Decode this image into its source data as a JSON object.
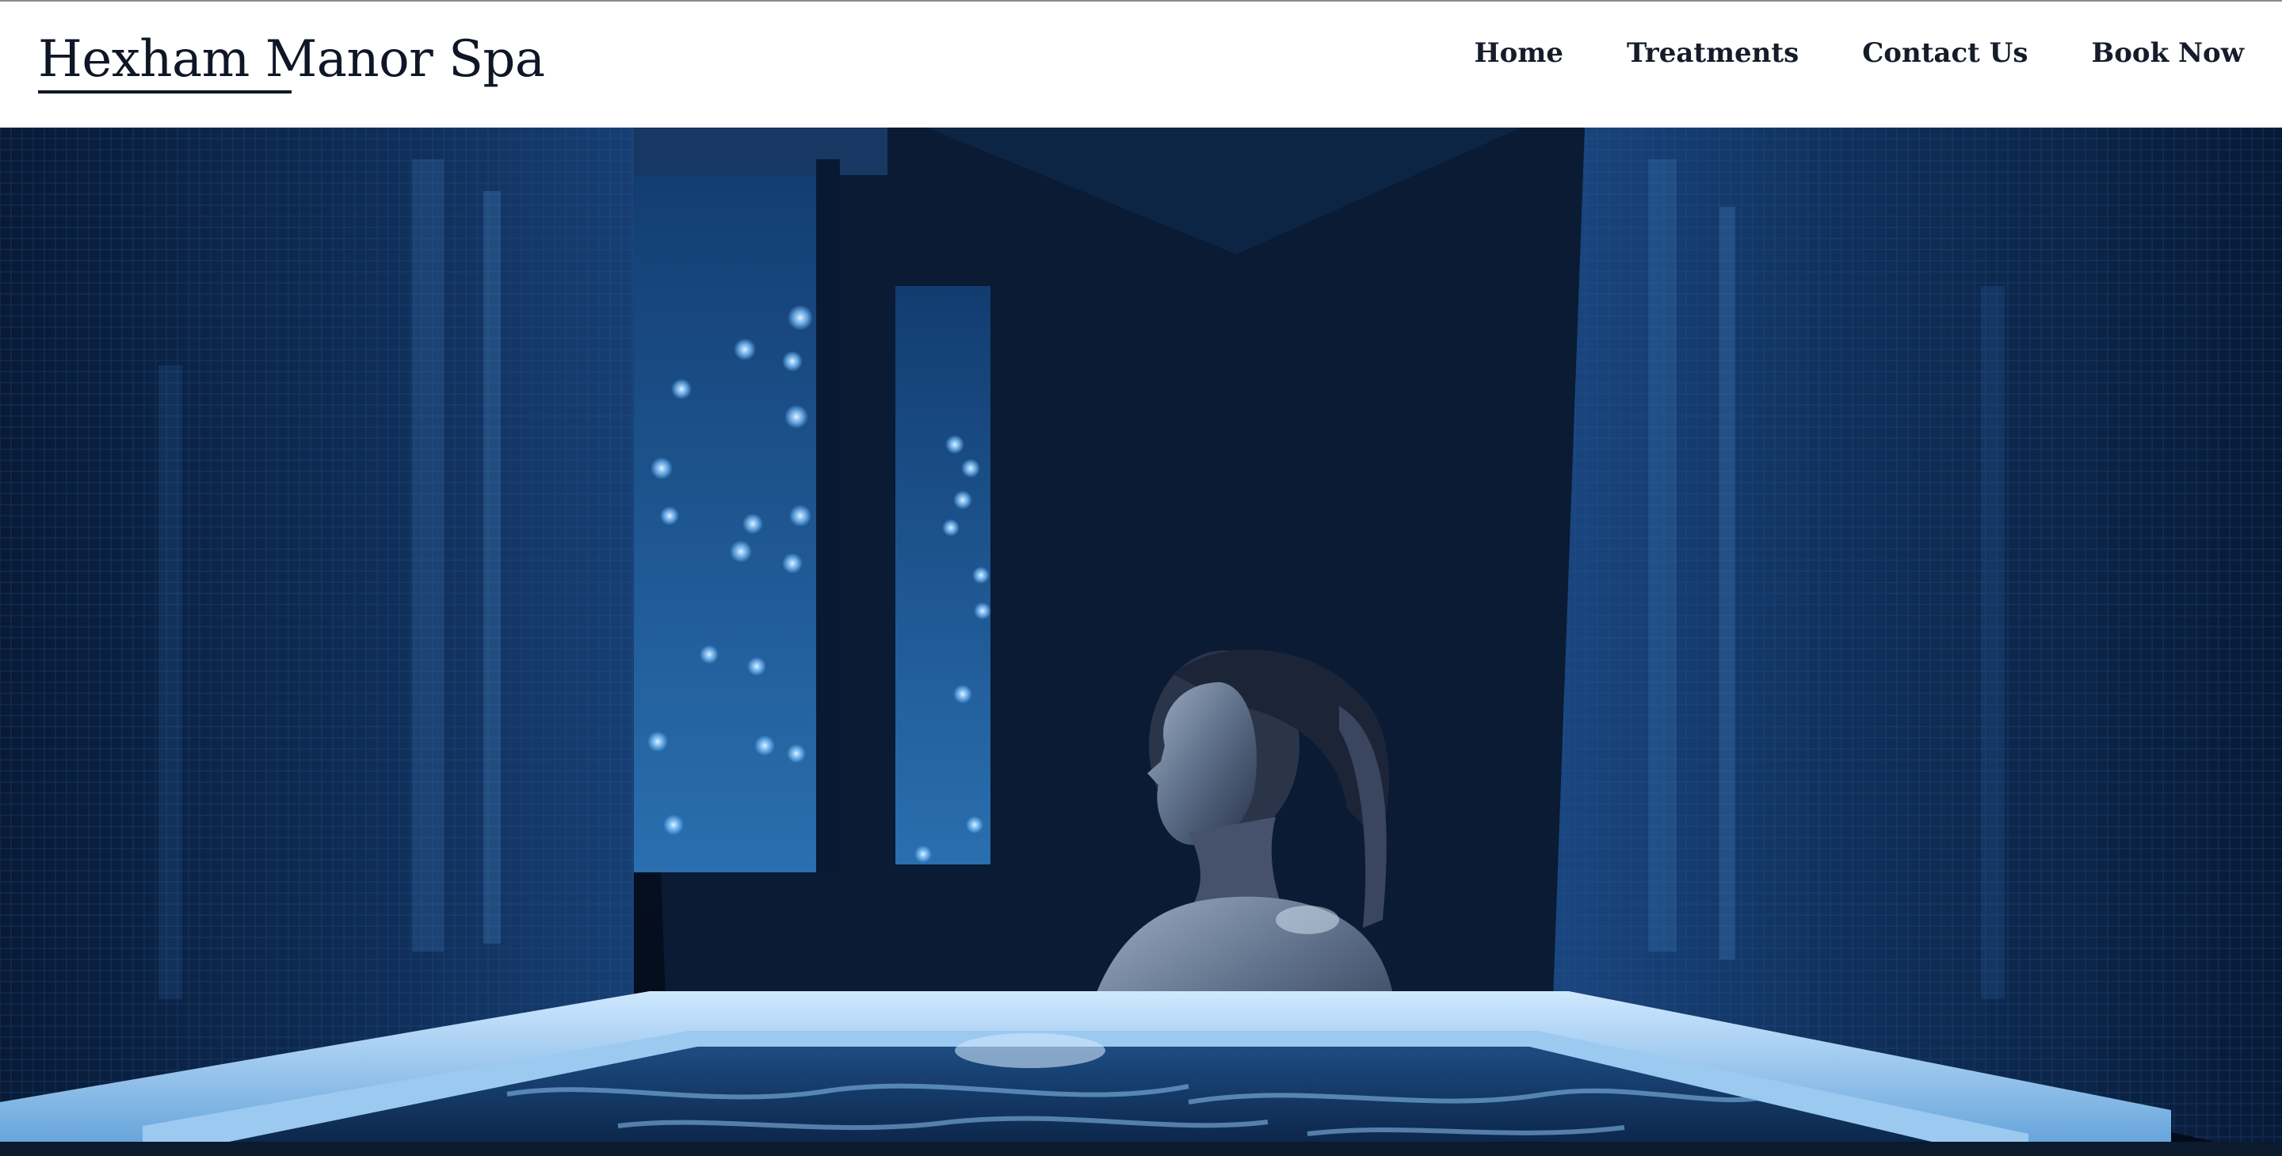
{
  "brand": {
    "name": "Hexham Manor Spa"
  },
  "nav": {
    "items": [
      {
        "label": "Home"
      },
      {
        "label": "Treatments"
      },
      {
        "label": "Contact Us"
      },
      {
        "label": "Book Now"
      }
    ]
  },
  "hero": {
    "image_subject": "woman relaxing in illuminated spa bath",
    "palette": {
      "deep": "#061124",
      "mid": "#0e2a52",
      "glow": "#5aa7e8",
      "water": "#1b4f86"
    }
  },
  "colors": {
    "header_bg": "#ffffff",
    "text": "#0f1626"
  }
}
